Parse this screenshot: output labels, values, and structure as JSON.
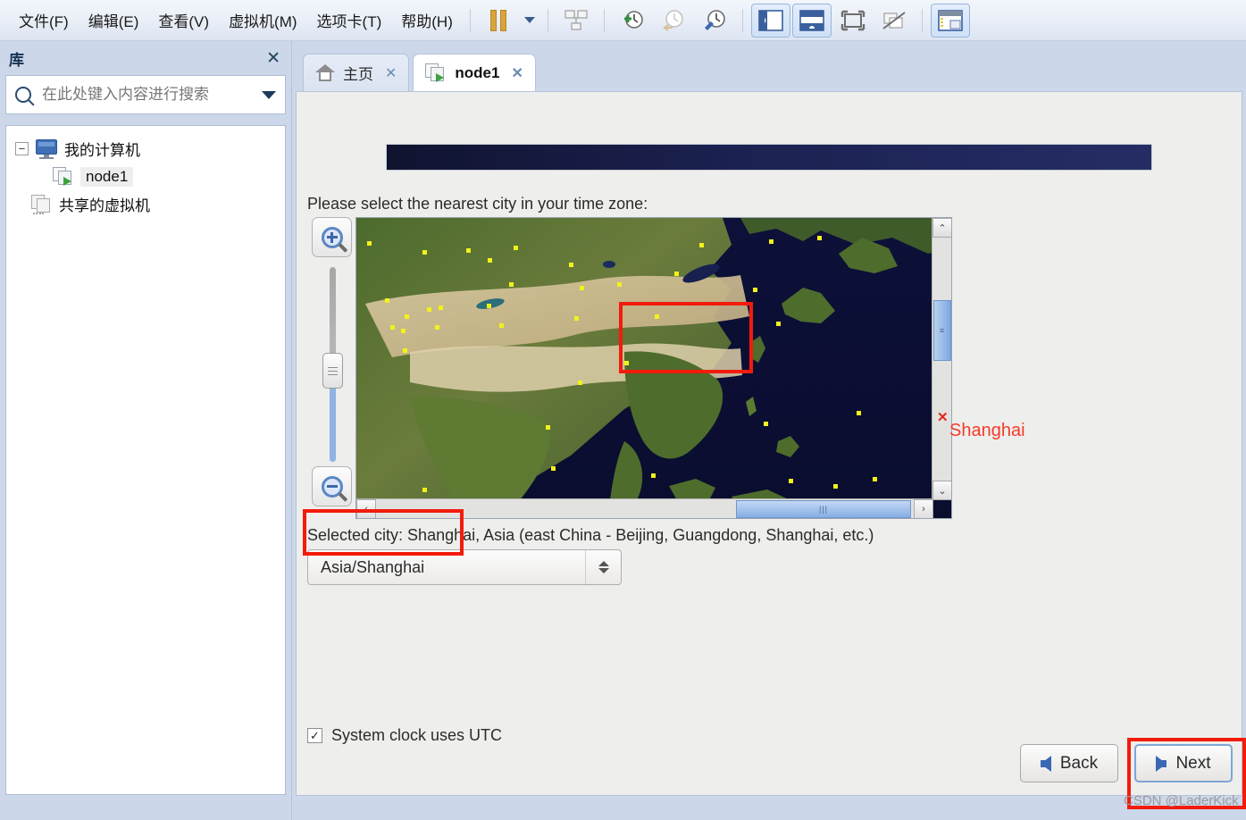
{
  "window": {
    "menus": [
      {
        "label": "文件(F)",
        "name": "menu-file"
      },
      {
        "label": "编辑(E)",
        "name": "menu-edit"
      },
      {
        "label": "查看(V)",
        "name": "menu-view"
      },
      {
        "label": "虚拟机(M)",
        "name": "menu-vm"
      },
      {
        "label": "选项卡(T)",
        "name": "menu-tabs"
      },
      {
        "label": "帮助(H)",
        "name": "menu-help"
      }
    ],
    "toolbar": {
      "icons": [
        "pause-icon",
        "dropdown-caret-icon",
        "snapshot-manage-icon",
        "take-snapshot-icon",
        "revert-snapshot-icon",
        "snapshot-manager-icon",
        "show-library-icon",
        "show-thumbnail-bar-icon",
        "fullscreen-icon",
        "unity-mode-icon",
        "console-view-icon"
      ]
    }
  },
  "sidebar": {
    "title": "库",
    "close_label": "✕",
    "search": {
      "placeholder": "在此处键入内容进行搜索",
      "value": "",
      "icon": "search-icon",
      "dropdown_icon": "chevron-down-icon"
    },
    "tree": [
      {
        "label": "我的计算机",
        "icon": "monitor-icon",
        "expander": "−",
        "selected": false
      },
      {
        "label": "node1",
        "icon": "vm-running-icon",
        "selected": true
      },
      {
        "label": "共享的虚拟机",
        "icon": "shared-vm-icon",
        "selected": false
      }
    ]
  },
  "tabs": [
    {
      "label": "主页",
      "icon": "home-icon",
      "active": false,
      "close": "✕"
    },
    {
      "label": "node1",
      "icon": "vm-running-icon",
      "active": true,
      "close": "✕"
    }
  ],
  "installer": {
    "prompt": "Please select the nearest city in your time zone:",
    "map": {
      "zoom_in_label": "+",
      "zoom_out_label": "−",
      "city_marker": "Shanghai",
      "marker_glyph": "✕",
      "scroll_left": "‹",
      "scroll_right": "›",
      "scroll_up": "⌃",
      "scroll_down": "⌄",
      "grip": "|||"
    },
    "selected_city": "Selected city: Shanghai, Asia (east China - Beijing, Guangdong, Shanghai, etc.)",
    "timezone_value": "Asia/Shanghai",
    "utc_checkbox": {
      "label": "System clock uses UTC",
      "checked": true,
      "mark": "✓"
    },
    "buttons": [
      {
        "label": "Back",
        "name": "back-button",
        "icon": "arrow-left-icon",
        "focused": false
      },
      {
        "label": "Next",
        "name": "next-button",
        "icon": "arrow-right-icon",
        "focused": true
      }
    ]
  },
  "watermark": "CSDN @LaderKick",
  "colors": {
    "accent": "#3a68b4",
    "annotation_red": "#f21b0c",
    "chrome_blue": "#ccd7ea",
    "banner_navy": "#1b2150"
  }
}
